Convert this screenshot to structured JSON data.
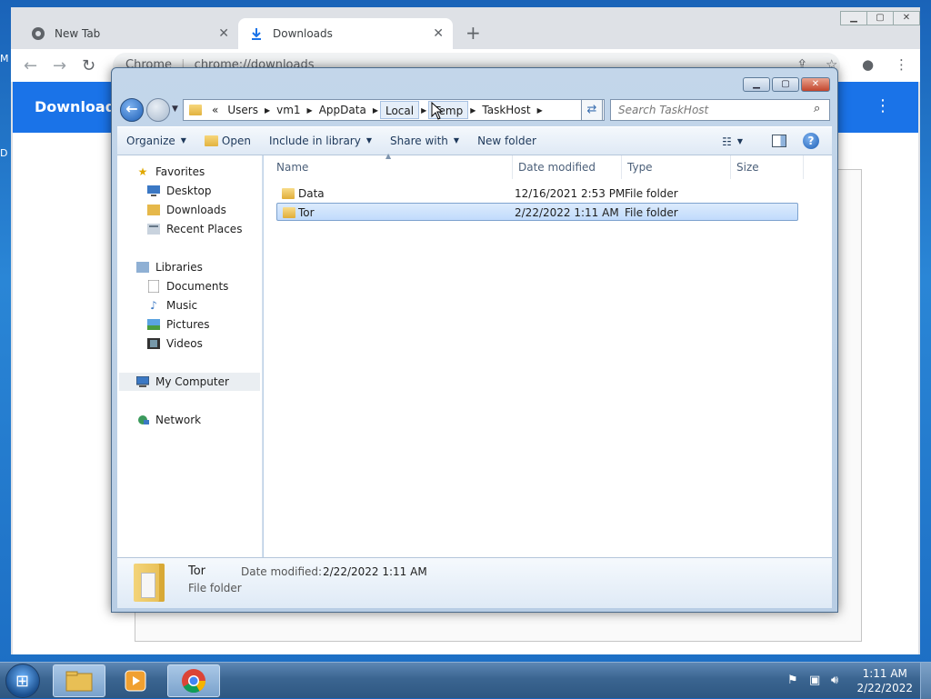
{
  "desktop": {
    "left_letter_1": "M",
    "left_letter_2": "D"
  },
  "chrome": {
    "tabs": [
      {
        "label": "New Tab",
        "icon": "chrome-icon"
      },
      {
        "label": "Downloads",
        "icon": "download-icon"
      }
    ],
    "new_tab": "+",
    "url_prefix": "Chrome",
    "url": "chrome://downloads",
    "page_title": "Downloads"
  },
  "explorer": {
    "address": [
      "«",
      "Users",
      "vm1",
      "AppData",
      "Local",
      "Temp",
      "TaskHost"
    ],
    "search_placeholder": "Search TaskHost",
    "toolbar": {
      "organize": "Organize",
      "open": "Open",
      "include": "Include in library",
      "share": "Share with",
      "new_folder": "New folder"
    },
    "nav": {
      "favorites": "Favorites",
      "desktop": "Desktop",
      "downloads": "Downloads",
      "recent": "Recent Places",
      "libraries": "Libraries",
      "documents": "Documents",
      "music": "Music",
      "pictures": "Pictures",
      "videos": "Videos",
      "computer": "My Computer",
      "network": "Network"
    },
    "columns": [
      "Name",
      "Date modified",
      "Type",
      "Size"
    ],
    "files": [
      {
        "name": "Data",
        "date": "12/16/2021 2:53 PM",
        "type": "File folder"
      },
      {
        "name": "Tor",
        "date": "2/22/2022 1:11 AM",
        "type": "File folder"
      }
    ],
    "details": {
      "name": "Tor",
      "type": "File folder",
      "date_label": "Date modified:",
      "date": "2/22/2022 1:11 AM"
    }
  },
  "taskbar": {
    "time": "1:11 AM",
    "date": "2/22/2022"
  }
}
